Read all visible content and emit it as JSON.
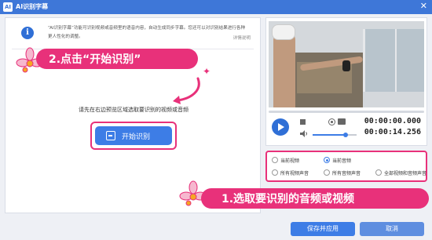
{
  "window": {
    "title": "AI识别字幕",
    "app_icon": "AI"
  },
  "info": {
    "text": "“AI识别字幕”功能可识别视频或音频里的语音内容，自动生成同步字幕。您还可以对识别结果进行各种更人性化的调整。",
    "details_link": "详情说明"
  },
  "main": {
    "callout_top": "2.点击“开始识别”",
    "hint": "请先在右边预览区域选取要识别的视频或音频",
    "start_button": "开始识别"
  },
  "player": {
    "progress": 0.0,
    "current_time": "00:00:00.000",
    "total_time": "00:00:14.256",
    "volume": 0.75
  },
  "options": {
    "current_video": "当前视频",
    "current_audio": "当前音频",
    "all_video_audio": "所有视频声音",
    "all_audio_audio": "所有音频声音",
    "all_video_and_audio": "全部视频和音频声音",
    "selected": "当前音频"
  },
  "callout_bottom": "1.选取要识别的音频或视频",
  "footer": {
    "apply_label": "保存并应用",
    "cancel_label": "取消"
  },
  "colors": {
    "accent": "#3d7de6",
    "titlebar": "#3e77d8",
    "highlight": "#e8317a"
  }
}
